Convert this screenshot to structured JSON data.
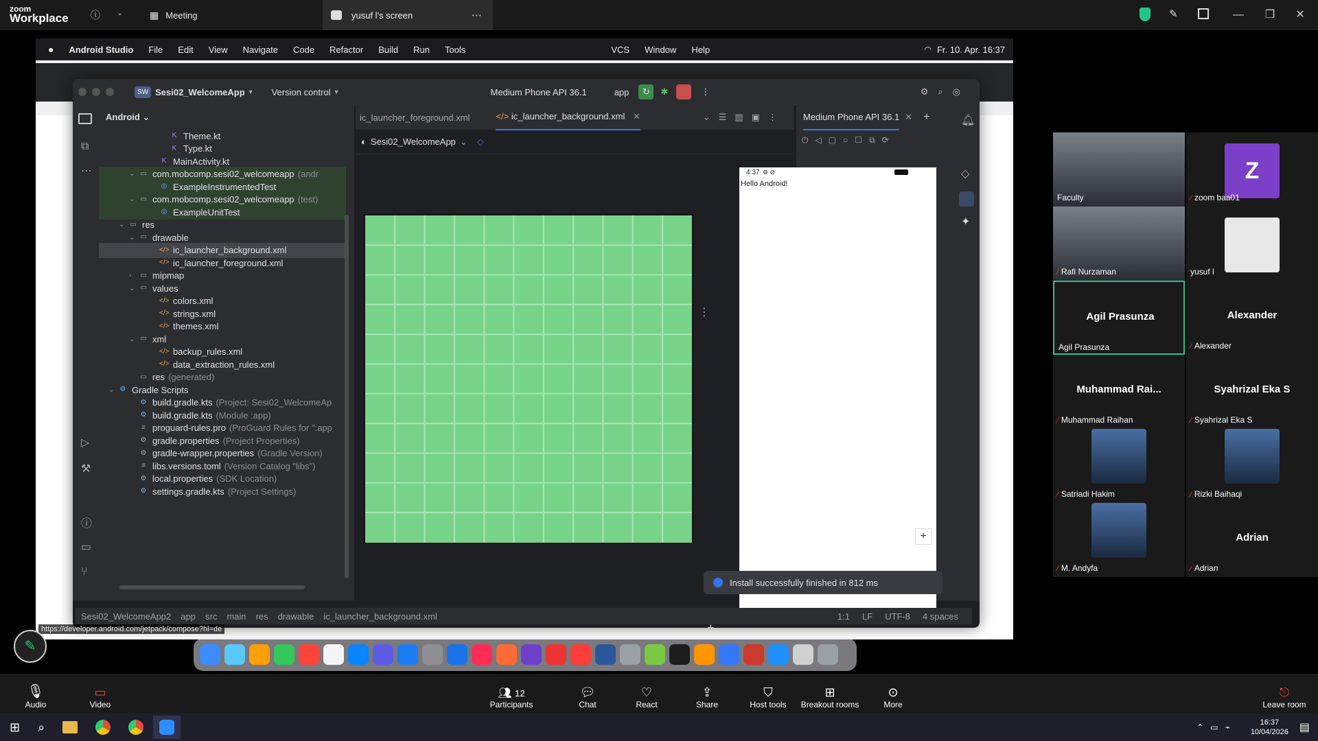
{
  "zoom": {
    "logo_line1": "zoom",
    "logo_line2": "Workplace",
    "meeting_label": "Meeting",
    "screen_tab_label": "yusuf l's screen"
  },
  "macmenu": {
    "app": "Android Studio",
    "items": [
      "File",
      "Edit",
      "View",
      "Navigate",
      "Code",
      "Refactor",
      "Build",
      "Run",
      "Tools"
    ],
    "right_items": [
      "VCS",
      "Window",
      "Help"
    ],
    "datetime": "Fr. 10. Apr.  16:37"
  },
  "studio": {
    "project_name": "Sesi02_WelcomeApp",
    "project_badge": "SW",
    "vcs": "Version control",
    "device": "Medium Phone API 36.1",
    "run_config": "app",
    "panel_title": "Android",
    "tree": [
      {
        "label": "Theme.kt",
        "depth": 5,
        "icon": "kotlin"
      },
      {
        "label": "Type.kt",
        "depth": 5,
        "icon": "kotlin"
      },
      {
        "label": "MainActivity.kt",
        "depth": 4,
        "icon": "kotlin"
      },
      {
        "label": "com.mobcomp.sesi02_welcomeapp",
        "extra": "(andr",
        "depth": 2,
        "icon": "folder",
        "chev": "v",
        "hl": true
      },
      {
        "label": "ExampleInstrumentedTest",
        "depth": 4,
        "icon": "class",
        "hl": true
      },
      {
        "label": "com.mobcomp.sesi02_welcomeapp",
        "extra": "(test)",
        "depth": 2,
        "icon": "folder",
        "chev": "v",
        "hl": true
      },
      {
        "label": "ExampleUnitTest",
        "depth": 4,
        "icon": "class",
        "hl": true
      },
      {
        "label": "res",
        "depth": 1,
        "icon": "folder",
        "chev": "v"
      },
      {
        "label": "drawable",
        "depth": 2,
        "icon": "folder",
        "chev": "v"
      },
      {
        "label": "ic_launcher_background.xml",
        "depth": 4,
        "icon": "xml",
        "sel": true
      },
      {
        "label": "ic_launcher_foreground.xml",
        "depth": 4,
        "icon": "xml"
      },
      {
        "label": "mipmap",
        "depth": 2,
        "icon": "folder",
        "chev": ">"
      },
      {
        "label": "values",
        "depth": 2,
        "icon": "folder",
        "chev": "v"
      },
      {
        "label": "colors.xml",
        "depth": 4,
        "icon": "xml"
      },
      {
        "label": "strings.xml",
        "depth": 4,
        "icon": "xml"
      },
      {
        "label": "themes.xml",
        "depth": 4,
        "icon": "xml"
      },
      {
        "label": "xml",
        "depth": 2,
        "icon": "folder",
        "chev": "v"
      },
      {
        "label": "backup_rules.xml",
        "depth": 4,
        "icon": "xml"
      },
      {
        "label": "data_extraction_rules.xml",
        "depth": 4,
        "icon": "xml"
      },
      {
        "label": "res",
        "extra": "(generated)",
        "depth": 2,
        "icon": "folder"
      },
      {
        "label": "Gradle Scripts",
        "depth": 0,
        "icon": "gradle",
        "chev": "v"
      },
      {
        "label": "build.gradle.kts",
        "extra": "(Project: Sesi02_WelcomeAp",
        "depth": 2,
        "icon": "gradle"
      },
      {
        "label": "build.gradle.kts",
        "extra": "(Module :app)",
        "depth": 2,
        "icon": "gradle"
      },
      {
        "label": "proguard-rules.pro",
        "extra": "(ProGuard Rules for \":app",
        "depth": 2,
        "icon": "file"
      },
      {
        "label": "gradle.properties",
        "extra": "(Project Properties)",
        "depth": 2,
        "icon": "gear"
      },
      {
        "label": "gradle-wrapper.properties",
        "extra": "(Gradle Version)",
        "depth": 2,
        "icon": "gear"
      },
      {
        "label": "libs.versions.toml",
        "extra": "(Version Catalog \"libs\")",
        "depth": 2,
        "icon": "file"
      },
      {
        "label": "local.properties",
        "extra": "(SDK Location)",
        "depth": 2,
        "icon": "gear"
      },
      {
        "label": "settings.gradle.kts",
        "extra": "(Project Settings)",
        "depth": 2,
        "icon": "gradle"
      }
    ],
    "tabs": [
      "ic_launcher_foreground.xml",
      "ic_launcher_background.xml"
    ],
    "editor_breadcrumb": "Sesi02_WelcomeApp",
    "device_tab": "Medium Phone API 36.1",
    "phone_time": "4:37",
    "phone_text": "Hello Android!",
    "toast": "Install successfully finished in 812 ms",
    "status_path": [
      "Sesi02_WelcomeApp2",
      "app",
      "src",
      "main",
      "res",
      "drawable",
      "ic_launcher_background.xml"
    ],
    "status_right": [
      "1:1",
      "LF",
      "UTF-8",
      "4 spaces"
    ],
    "url_hint": "https://developer.android.com/jetpack/compose?hl=de"
  },
  "gallery": [
    {
      "name": "Faculty",
      "type": "video",
      "muted": false
    },
    {
      "name": "zoom baa01",
      "type": "avatar",
      "initial": "Z",
      "muted": true
    },
    {
      "name": "Rafi Nurzaman",
      "type": "video",
      "muted": true
    },
    {
      "name": "yusuf l",
      "type": "blank",
      "muted": false
    },
    {
      "name": "Agil Prasunza",
      "big": "Agil Prasunza",
      "type": "name",
      "muted": false,
      "active": true
    },
    {
      "name": "Alexander",
      "big": "Alexander",
      "type": "name",
      "muted": true
    },
    {
      "name": "Muhammad Raihan",
      "big": "Muhammad  Rai...",
      "type": "name",
      "muted": true
    },
    {
      "name": "Syahrizal Eka S",
      "big": "Syahrizal Eka S",
      "type": "name",
      "muted": true
    },
    {
      "name": "Satriadi Hakim",
      "type": "photo",
      "muted": true
    },
    {
      "name": "Rizki Baihaqi",
      "type": "photo",
      "muted": true
    },
    {
      "name": "M. Andyfa",
      "type": "photo",
      "muted": true
    },
    {
      "name": "Adrian",
      "big": "Adrian",
      "type": "name",
      "muted": true
    }
  ],
  "controls": {
    "audio": "Audio",
    "video": "Video",
    "participants": "Participants",
    "participants_count": "12",
    "chat": "Chat",
    "react": "React",
    "share": "Share",
    "host_tools": "Host tools",
    "breakout": "Breakout rooms",
    "more": "More",
    "leave": "Leave room"
  },
  "taskbar": {
    "time": "16:37",
    "date": "10/04/2026"
  },
  "colors": {
    "android_green": "#76d389",
    "zoom_green": "#25c48a",
    "accent_blue": "#3574f0"
  }
}
